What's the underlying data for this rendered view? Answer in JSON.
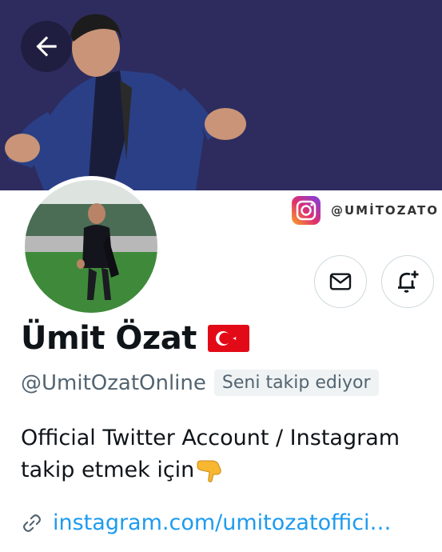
{
  "header": {
    "back_icon": "arrow-left-icon",
    "banner_color": "#2e2c5e",
    "instagram_handle": "@UMİTOZATO"
  },
  "actions": {
    "message_icon": "envelope-icon",
    "notify_icon": "bell-plus-icon"
  },
  "profile": {
    "name": "Ümit Özat",
    "flag_icon": "turkey-flag-icon",
    "handle": "@UmitOzatOnline",
    "follows_you": "Seni takip ediyor",
    "bio_line1": "Official Twitter Account / Instagram",
    "bio_line2": "takip etmek için",
    "bio_emoji_icon": "backhand-index-pointing-down-icon",
    "link_icon": "link-icon",
    "link_text": "instagram.com/umitozatoffici…",
    "link_color": "#1d9bf0"
  }
}
